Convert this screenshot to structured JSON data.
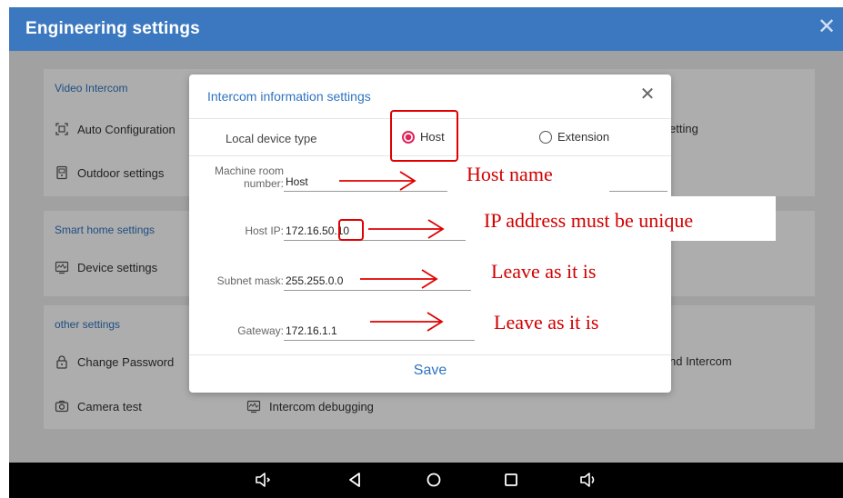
{
  "app": {
    "title": "Engineering settings"
  },
  "background": {
    "sections": [
      {
        "title": "Video Intercom",
        "items": [
          "Auto Configuration",
          "Outdoor settings"
        ],
        "right_items": [
          "etting"
        ]
      },
      {
        "title": "Smart home settings",
        "items": [
          "Device settings"
        ]
      },
      {
        "title": "other settings",
        "items": [
          "Change Password",
          "Camera test"
        ],
        "right_items": [
          "nd Intercom"
        ],
        "extra_item": "Intercom debugging"
      }
    ]
  },
  "dialog": {
    "title": "Intercom information settings",
    "device_type_label": "Local device type",
    "option_host": "Host",
    "option_extension": "Extension",
    "selected": "Host",
    "machine_room_label_1": "Machine room",
    "machine_room_label_2": "number:",
    "machine_room_value": "Host",
    "host_ip_label": "Host IP:",
    "host_ip_prefix": "172.16.50.",
    "host_ip_suffix": "10",
    "subnet_label": "Subnet mask:",
    "subnet_value": "255.255.0.0",
    "gateway_label": "Gateway:",
    "gateway_value": "172.16.1.1",
    "save_label": "Save"
  },
  "annotations": {
    "host_name": "Host name",
    "ip_unique": "IP address must be unique",
    "leave_subnet": "Leave as it is",
    "leave_gateway": "Leave as it is"
  },
  "colors": {
    "accent": "#3c78c0",
    "link": "#2f74c0",
    "annotation": "#d10000",
    "radio_selected": "#e0245e"
  },
  "icons": [
    "close-icon",
    "auto-config-icon",
    "outdoor-icon",
    "device-settings-icon",
    "lock-icon",
    "camera-icon",
    "intercom-debug-icon",
    "volume-down-icon",
    "back-icon",
    "home-icon",
    "recents-icon",
    "volume-up-icon"
  ]
}
